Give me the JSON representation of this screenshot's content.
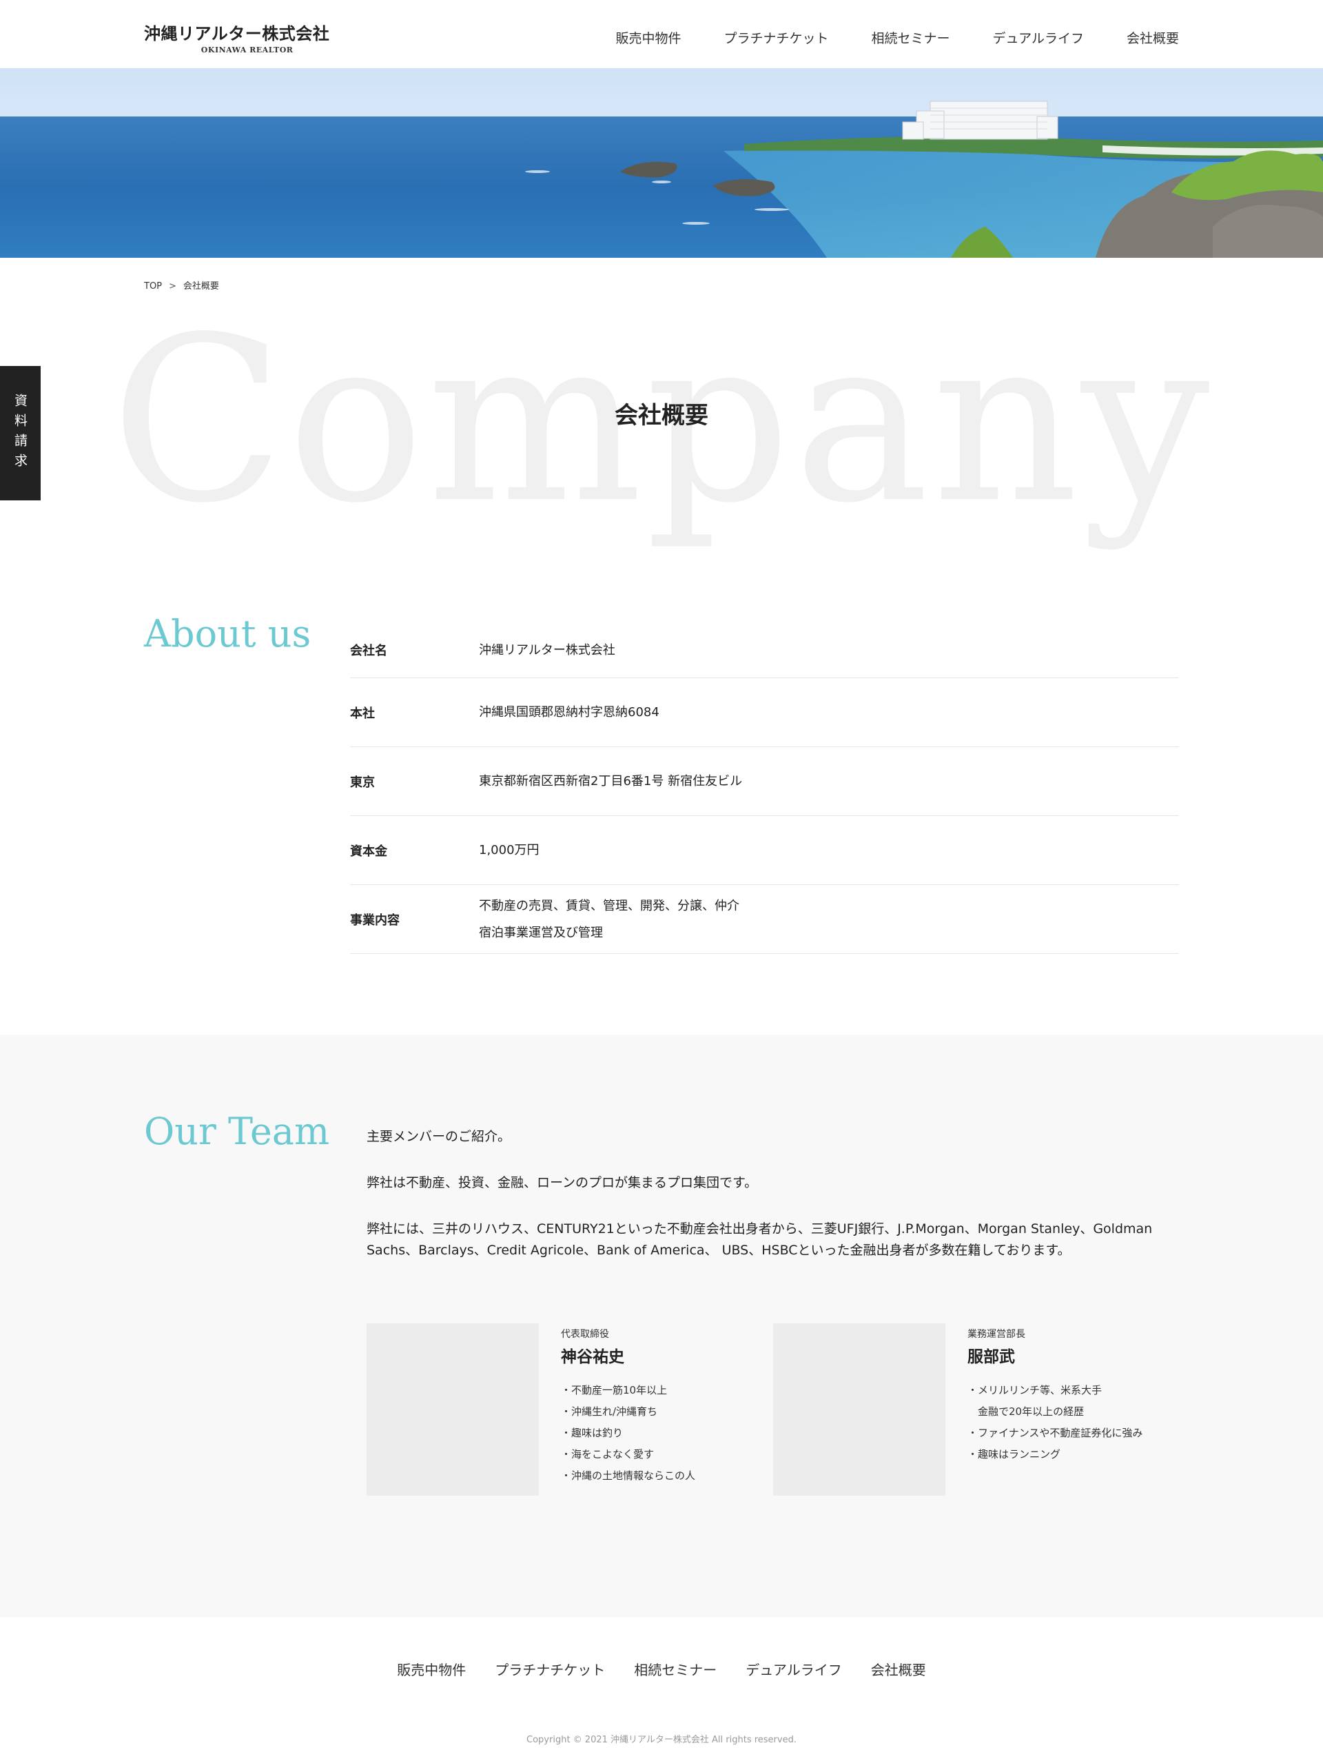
{
  "header": {
    "logo_jp": "沖縄リアルター株式会社",
    "logo_en": "OKINAWA REALTOR",
    "nav": [
      "販売中物件",
      "プラチナチケット",
      "相続セミナー",
      "デュアルライフ",
      "会社概要"
    ]
  },
  "breadcrumb": {
    "home": "TOP",
    "separator": ">",
    "current": "会社概要"
  },
  "side_tab": {
    "label": "資料請求"
  },
  "title": {
    "background_word": "Company",
    "label": "会社概要"
  },
  "about": {
    "heading": "About us",
    "rows": [
      {
        "label": "会社名",
        "value": [
          "沖縄リアルター株式会社"
        ]
      },
      {
        "label": "本社",
        "value": [
          "沖縄県国頭郡恩納村字恩納6084"
        ]
      },
      {
        "label": "東京",
        "value": [
          "東京都新宿区西新宿2丁目6番1号 新宿住友ビル"
        ]
      },
      {
        "label": "資本金",
        "value": [
          "1,000万円"
        ]
      },
      {
        "label": "事業内容",
        "value": [
          "不動産の売買、賃貸、管理、開発、分譲、仲介",
          "宿泊事業運営及び管理"
        ]
      }
    ]
  },
  "team": {
    "heading": "Our Team",
    "intro": [
      "主要メンバーのご紹介。",
      "弊社は不動産、投資、金融、ローンのプロが集まるプロ集団です。",
      "弊社には、三井のリハウス、CENTURY21といった不動産会社出身者から、三菱UFJ銀行、J.P.Morgan、Morgan Stanley、Goldman Sachs、Barclays、Credit Agricole、Bank of America、 UBS、HSBCといった金融出身者が多数在籍しております。"
    ],
    "members": [
      {
        "role": "代表取締役",
        "name": "神谷祐史",
        "points": [
          "・不動産一筋10年以上",
          "・沖縄生れ/沖縄育ち",
          "・趣味は釣り",
          "・海をこよなく愛す",
          "・沖縄の土地情報ならこの人"
        ]
      },
      {
        "role": "業務運営部長",
        "name": "服部武",
        "points": [
          "・メリルリンチ等、米系大手",
          "　金融で20年以上の経歴",
          "・ファイナンスや不動産証券化に強み",
          "・趣味はランニング"
        ]
      }
    ]
  },
  "footer": {
    "nav": [
      "販売中物件",
      "プラチナチケット",
      "相続セミナー",
      "デュアルライフ",
      "会社概要"
    ],
    "copyright": "Copyright © 2021 沖縄リアルター株式会社 All rights reserved."
  },
  "colors": {
    "accent": "#6dc9d1",
    "side_tab_bg": "#222222",
    "team_bg": "#f8f8f8"
  }
}
